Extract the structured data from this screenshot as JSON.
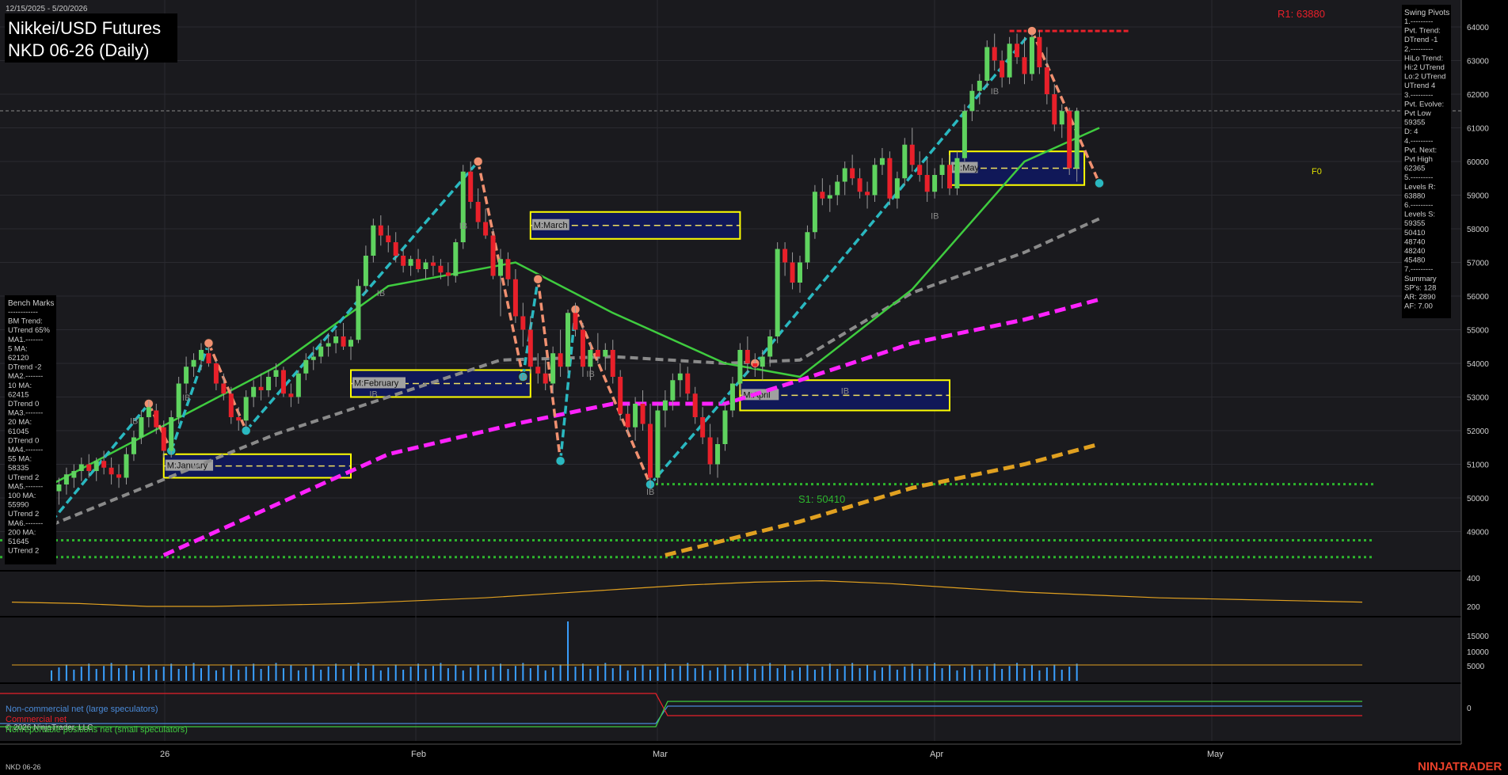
{
  "header": {
    "date_range": "12/15/2025 - 5/20/2026",
    "title_line1": "Nikkei/USD Futures",
    "title_line2": "NKD 06-26 (Daily)"
  },
  "footer": {
    "instrument": "NKD 06-26",
    "copyright": "© 2026 NinjaTrader, LLC",
    "brand": "NINJATRADER"
  },
  "colors": {
    "background": "#000000",
    "price_panel": "#1a1a1e",
    "up_candle": "#5fd35f",
    "down_candle": "#e8202a",
    "ma20": "#3fcc3f",
    "ma55": "#8a8a8a",
    "ma100": "#ff22ff",
    "ma200": "#e0a020",
    "swing_up": "#2ab8c0",
    "swing_down": "#f09070",
    "month_box": "#101858",
    "month_box_border": "#ffff00"
  },
  "swing_pivots": {
    "title": "Swing Pivots",
    "lines": [
      "1.---------",
      "Pvt. Trend:",
      "DTrend -1",
      "2.---------",
      "HiLo Trend:",
      "Hi:2 UTrend",
      "Lo:2 UTrend",
      "UTrend 4",
      "3.---------",
      "Pvt. Evolve:",
      "Pvt Low",
      "59355",
      "D: 4",
      "4.---------",
      "Pvt. Next:",
      "Pvt High",
      "62365",
      "5.---------",
      "Levels R:",
      "63880",
      "6.---------",
      "Levels S:",
      "59355",
      "50410",
      "48740",
      "48240",
      "45480",
      "7.---------",
      "Summary",
      "SP's: 128",
      "AR: 2890",
      "AF: 7.00"
    ]
  },
  "bench_marks": {
    "title": "Bench Marks",
    "lines": [
      "------------",
      "BM Trend:",
      "UTrend 65%",
      "MA1.-------",
      "5 MA:",
      "62120",
      "DTrend -2",
      "MA2.-------",
      "10 MA:",
      "62415",
      "DTrend 0",
      "MA3.-------",
      "20 MA:",
      "61045",
      "DTrend 0",
      "MA4.-------",
      "55 MA:",
      "58335",
      "UTrend 2",
      "MA5.-------",
      "100 MA:",
      "55990",
      "UTrend 2",
      "MA6.-------",
      "200 MA:",
      "51645",
      "UTrend 2"
    ]
  },
  "levels": {
    "r1": "R1: 63880",
    "s1": "S1: 50410",
    "f0": "F0"
  },
  "month_labels": [
    "M:January",
    "M:February",
    "M:March",
    "M:April",
    "M:May"
  ],
  "ib_label": "IB",
  "legend": {
    "noncommercial": "Non-commercial net (large speculators)",
    "commercial": "Commercial net",
    "nonreportable": "Nonreportable positions net (small speculators)"
  },
  "x_axis": {
    "labels": [
      "26",
      "Feb",
      "Mar",
      "Apr",
      "May"
    ]
  },
  "y_axis": {
    "price_ticks": [
      "64000",
      "63000",
      "62000",
      "61000",
      "60000",
      "59000",
      "58000",
      "57000",
      "56000",
      "55000",
      "54000",
      "53000",
      "52000",
      "51000",
      "50000",
      "49000"
    ],
    "atr_ticks": [
      "400",
      "200"
    ],
    "volume_ticks": [
      "15000",
      "10000",
      "5000"
    ],
    "cot_ticks": [
      "0"
    ]
  },
  "chart_data": {
    "type": "candlestick",
    "instrument": "NKD 06-26",
    "timeframe": "Daily",
    "ylim": [
      48200,
      64600
    ],
    "candles": [
      [
        49300,
        50400,
        49000,
        50200
      ],
      [
        50200,
        50600,
        49800,
        50400
      ],
      [
        50400,
        50900,
        50100,
        50700
      ],
      [
        50600,
        51000,
        50300,
        50800
      ],
      [
        50800,
        51200,
        50500,
        51000
      ],
      [
        51000,
        51300,
        50600,
        50800
      ],
      [
        50800,
        51200,
        50500,
        51100
      ],
      [
        51100,
        51400,
        50700,
        50900
      ],
      [
        50900,
        51200,
        50400,
        50700
      ],
      [
        50700,
        51000,
        50300,
        50600
      ],
      [
        50600,
        51500,
        50400,
        51300
      ],
      [
        51300,
        52000,
        51100,
        51800
      ],
      [
        51800,
        52600,
        51600,
        52400
      ],
      [
        52400,
        52900,
        52100,
        52700
      ],
      [
        52600,
        52800,
        51900,
        52100
      ],
      [
        52100,
        52300,
        51200,
        51400
      ],
      [
        51400,
        52600,
        51200,
        52400
      ],
      [
        52400,
        53600,
        52200,
        53400
      ],
      [
        53400,
        54200,
        53100,
        53900
      ],
      [
        53900,
        54300,
        53600,
        54100
      ],
      [
        54100,
        54600,
        53800,
        54400
      ],
      [
        54300,
        54500,
        53900,
        54000
      ],
      [
        54000,
        54100,
        53200,
        53400
      ],
      [
        53400,
        53700,
        52900,
        53100
      ],
      [
        53100,
        53300,
        52200,
        52400
      ],
      [
        52400,
        52700,
        52000,
        52300
      ],
      [
        52300,
        53200,
        52100,
        53000
      ],
      [
        53000,
        53500,
        52700,
        53300
      ],
      [
        53300,
        53700,
        52900,
        53200
      ],
      [
        53200,
        53800,
        53000,
        53600
      ],
      [
        53600,
        54000,
        53300,
        53800
      ],
      [
        53800,
        53900,
        53000,
        53100
      ],
      [
        53100,
        53400,
        52700,
        53000
      ],
      [
        53000,
        53800,
        52800,
        53700
      ],
      [
        53700,
        54300,
        53500,
        54100
      ],
      [
        54100,
        54500,
        53800,
        54200
      ],
      [
        54200,
        54700,
        54000,
        54500
      ],
      [
        54500,
        54900,
        54200,
        54600
      ],
      [
        54600,
        55000,
        54300,
        54800
      ],
      [
        54800,
        55200,
        54400,
        54500
      ],
      [
        54500,
        54800,
        54100,
        54700
      ],
      [
        54700,
        56500,
        54600,
        56300
      ],
      [
        56300,
        57500,
        56100,
        57200
      ],
      [
        57200,
        58300,
        57000,
        58100
      ],
      [
        58100,
        58400,
        57500,
        57800
      ],
      [
        57800,
        58100,
        57300,
        57600
      ],
      [
        57600,
        57900,
        57000,
        57200
      ],
      [
        57200,
        57400,
        56700,
        56900
      ],
      [
        56900,
        57200,
        56600,
        57100
      ],
      [
        57100,
        57400,
        56700,
        56800
      ],
      [
        56800,
        57100,
        56500,
        57000
      ],
      [
        57000,
        57200,
        56600,
        56900
      ],
      [
        56900,
        57100,
        56500,
        56700
      ],
      [
        56700,
        57000,
        56300,
        56600
      ],
      [
        56600,
        57700,
        56400,
        57600
      ],
      [
        57600,
        59900,
        57400,
        59700
      ],
      [
        59700,
        60000,
        58600,
        58800
      ],
      [
        58800,
        59200,
        58000,
        58200
      ],
      [
        58200,
        58600,
        57700,
        57800
      ],
      [
        57800,
        58000,
        56500,
        56600
      ],
      [
        56600,
        57400,
        55400,
        57100
      ],
      [
        57100,
        57300,
        56300,
        56500
      ],
      [
        56500,
        56800,
        55200,
        55400
      ],
      [
        55400,
        55800,
        54500,
        55000
      ],
      [
        55000,
        55400,
        53700,
        53900
      ],
      [
        53900,
        54300,
        53400,
        53700
      ],
      [
        53700,
        54100,
        53200,
        53400
      ],
      [
        53400,
        54500,
        53100,
        54300
      ],
      [
        54300,
        55000,
        53600,
        53900
      ],
      [
        53900,
        55600,
        53700,
        55500
      ],
      [
        55500,
        55800,
        54800,
        55000
      ],
      [
        55000,
        55200,
        53600,
        53900
      ],
      [
        53900,
        54600,
        53500,
        54400
      ],
      [
        54400,
        54900,
        54000,
        54200
      ],
      [
        54200,
        54600,
        53800,
        54400
      ],
      [
        54400,
        54700,
        53400,
        53600
      ],
      [
        53600,
        53800,
        52300,
        52500
      ],
      [
        52500,
        52800,
        51900,
        52100
      ],
      [
        52100,
        53000,
        51700,
        52800
      ],
      [
        52800,
        53200,
        52000,
        52200
      ],
      [
        52200,
        52800,
        50300,
        50600
      ],
      [
        50600,
        52800,
        50400,
        52600
      ],
      [
        52600,
        53200,
        52100,
        52900
      ],
      [
        52900,
        53700,
        52600,
        53500
      ],
      [
        53500,
        54000,
        53000,
        53700
      ],
      [
        53700,
        53900,
        52900,
        53100
      ],
      [
        53100,
        53300,
        52200,
        52400
      ],
      [
        52400,
        52700,
        51600,
        51800
      ],
      [
        51800,
        52200,
        50700,
        51000
      ],
      [
        51000,
        51800,
        50600,
        51600
      ],
      [
        51600,
        52800,
        51400,
        52600
      ],
      [
        52600,
        53600,
        52400,
        53400
      ],
      [
        53400,
        54600,
        53200,
        54400
      ],
      [
        54400,
        54800,
        53700,
        54000
      ],
      [
        54000,
        54300,
        53600,
        53900
      ],
      [
        53900,
        54400,
        53500,
        54200
      ],
      [
        54200,
        55000,
        53900,
        54800
      ],
      [
        54800,
        57600,
        54600,
        57400
      ],
      [
        57400,
        57600,
        56600,
        57000
      ],
      [
        57000,
        57300,
        56200,
        56400
      ],
      [
        56400,
        57200,
        56100,
        57000
      ],
      [
        57000,
        58100,
        56800,
        57900
      ],
      [
        57900,
        59300,
        57700,
        59100
      ],
      [
        59100,
        59500,
        58700,
        58900
      ],
      [
        58900,
        59300,
        58500,
        59000
      ],
      [
        59000,
        59600,
        58700,
        59400
      ],
      [
        59400,
        60000,
        59000,
        59800
      ],
      [
        59800,
        60200,
        59300,
        59500
      ],
      [
        59500,
        59800,
        58900,
        59100
      ],
      [
        59100,
        59400,
        58600,
        59000
      ],
      [
        59000,
        60100,
        58800,
        59900
      ],
      [
        59900,
        60400,
        59600,
        60100
      ],
      [
        60100,
        60300,
        58700,
        58900
      ],
      [
        58900,
        59700,
        58600,
        59500
      ],
      [
        59500,
        60700,
        59300,
        60500
      ],
      [
        60500,
        61000,
        59700,
        59900
      ],
      [
        59900,
        60300,
        59400,
        59600
      ],
      [
        59600,
        60100,
        58800,
        59100
      ],
      [
        59100,
        59800,
        58900,
        59600
      ],
      [
        59600,
        60100,
        59200,
        59900
      ],
      [
        59900,
        60200,
        59000,
        59200
      ],
      [
        59200,
        60300,
        59000,
        60100
      ],
      [
        60100,
        61700,
        60000,
        61500
      ],
      [
        61500,
        62300,
        61200,
        62100
      ],
      [
        62100,
        62600,
        61700,
        62400
      ],
      [
        62400,
        63600,
        62200,
        63400
      ],
      [
        63400,
        63800,
        62700,
        63000
      ],
      [
        63000,
        63300,
        62200,
        62500
      ],
      [
        62500,
        63700,
        62300,
        63500
      ],
      [
        63500,
        63800,
        62900,
        63100
      ],
      [
        63100,
        63700,
        62300,
        62600
      ],
      [
        62600,
        63800,
        62400,
        63700
      ],
      [
        63700,
        63900,
        62600,
        62800
      ],
      [
        62800,
        63400,
        61700,
        62000
      ],
      [
        62000,
        62300,
        60900,
        61100
      ],
      [
        61100,
        61700,
        60700,
        61500
      ],
      [
        61500,
        61600,
        59600,
        59800
      ],
      [
        59800,
        61600,
        59400,
        61500
      ]
    ],
    "ma20": [
      [
        0,
        50400
      ],
      [
        30,
        53900
      ],
      [
        45,
        56300
      ],
      [
        62,
        57000
      ],
      [
        75,
        55500
      ],
      [
        90,
        54000
      ],
      [
        100,
        53600
      ],
      [
        115,
        56200
      ],
      [
        130,
        60000
      ],
      [
        140,
        61000
      ]
    ],
    "ma55": [
      [
        0,
        49200
      ],
      [
        30,
        51900
      ],
      [
        45,
        53000
      ],
      [
        60,
        54100
      ],
      [
        75,
        54200
      ],
      [
        90,
        54000
      ],
      [
        100,
        54100
      ],
      [
        115,
        56100
      ],
      [
        130,
        57300
      ],
      [
        140,
        58300
      ]
    ],
    "ma100": [
      [
        15,
        48300
      ],
      [
        45,
        51300
      ],
      [
        62,
        52200
      ],
      [
        75,
        52800
      ],
      [
        90,
        52800
      ],
      [
        100,
        53500
      ],
      [
        115,
        54600
      ],
      [
        130,
        55300
      ],
      [
        140,
        55900
      ]
    ],
    "ma200": [
      [
        82,
        48300
      ],
      [
        100,
        49300
      ],
      [
        115,
        50300
      ],
      [
        130,
        51000
      ],
      [
        140,
        51600
      ]
    ],
    "swings": [
      [
        0,
        49300
      ],
      [
        13,
        52800
      ],
      [
        16,
        51400
      ],
      [
        21,
        54600
      ],
      [
        26,
        52000
      ],
      [
        57,
        60000
      ],
      [
        63,
        53600
      ],
      [
        65,
        56500
      ],
      [
        68,
        51100
      ],
      [
        70,
        55600
      ],
      [
        80,
        50400
      ],
      [
        94,
        54000
      ],
      [
        131,
        63880
      ],
      [
        140,
        59355
      ]
    ],
    "levels": {
      "R1": 63880,
      "S1": 50410,
      "S2": 48740,
      "S3": 48240
    },
    "month_boxes": [
      {
        "label": "M:January",
        "from": 15,
        "to": 40,
        "low": 50600,
        "high": 51300
      },
      {
        "label": "M:February",
        "from": 40,
        "to": 64,
        "low": 53000,
        "high": 53800
      },
      {
        "label": "M:March",
        "from": 64,
        "to": 92,
        "low": 57700,
        "high": 58500
      },
      {
        "label": "M:April",
        "from": 92,
        "to": 120,
        "low": 52600,
        "high": 53500
      },
      {
        "label": "M:May",
        "from": 120,
        "to": 138,
        "low": 59300,
        "high": 60300
      }
    ],
    "atr": [
      230,
      220,
      200,
      200,
      210,
      220,
      240,
      260,
      290,
      320,
      350,
      370,
      380,
      360,
      330,
      300,
      280,
      260,
      250,
      240,
      230
    ],
    "volume_avg": 4500,
    "volume_spike": 18000,
    "cot": {
      "noncommercial": [
        -1,
        -1,
        0.1,
        0.1
      ],
      "commercial": [
        0.9,
        0.9,
        -0.5,
        -0.5
      ],
      "nonreportable": [
        -1.2,
        -1.2,
        0.4,
        0.4
      ]
    }
  }
}
